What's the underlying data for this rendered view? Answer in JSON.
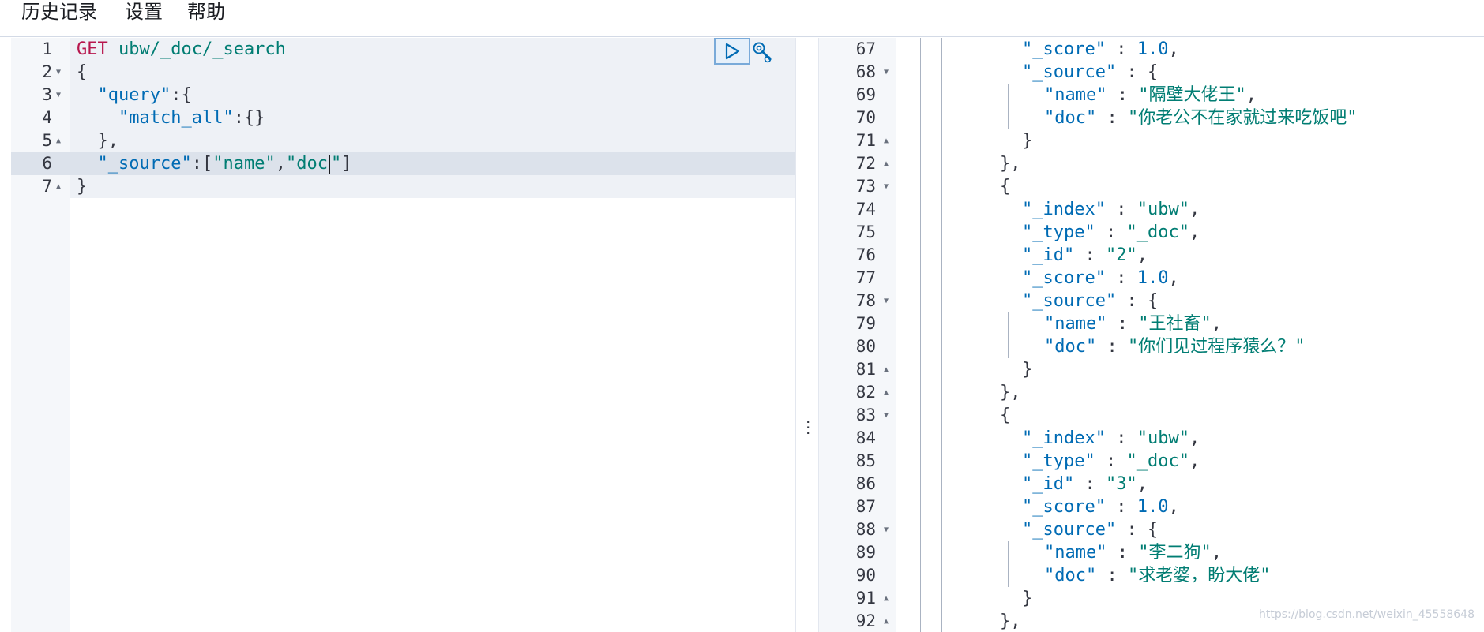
{
  "menu": {
    "history": "历史记录",
    "settings": "设置",
    "help": "帮助"
  },
  "request": {
    "lines": [
      {
        "num": "1",
        "fold": "",
        "tokens": [
          [
            "m",
            "GET"
          ],
          [
            "p",
            " "
          ],
          [
            "s",
            "ubw/_doc/_search"
          ]
        ]
      },
      {
        "num": "2",
        "fold": "down",
        "tokens": [
          [
            "p",
            "{"
          ]
        ]
      },
      {
        "num": "3",
        "fold": "down",
        "tokens": [
          [
            "p",
            "  "
          ],
          [
            "k",
            "\"query\""
          ],
          [
            "p",
            ":{"
          ]
        ]
      },
      {
        "num": "4",
        "fold": "",
        "tokens": [
          [
            "p",
            "    "
          ],
          [
            "k",
            "\"match_all\""
          ],
          [
            "p",
            ":{}"
          ]
        ]
      },
      {
        "num": "5",
        "fold": "up",
        "tokens": [
          [
            "p",
            "  },"
          ]
        ]
      },
      {
        "num": "6",
        "fold": "",
        "tokens": [
          [
            "p",
            "  "
          ],
          [
            "k",
            "\"_source\""
          ],
          [
            "p",
            ":["
          ],
          [
            "s",
            "\"name\""
          ],
          [
            "p",
            ","
          ],
          [
            "s",
            "\"doc"
          ],
          [
            "caret",
            ""
          ],
          [
            "s",
            "\""
          ],
          [
            "p",
            "]"
          ]
        ]
      },
      {
        "num": "7",
        "fold": "up",
        "tokens": [
          [
            "p",
            "}"
          ]
        ]
      }
    ]
  },
  "response": {
    "lines": [
      {
        "num": "67",
        "fold": "",
        "indent": 4,
        "tokens": [
          [
            "k",
            "\"_score\""
          ],
          [
            "p",
            " : "
          ],
          [
            "n",
            "1.0"
          ],
          [
            "p",
            ","
          ]
        ]
      },
      {
        "num": "68",
        "fold": "down",
        "indent": 4,
        "tokens": [
          [
            "k",
            "\"_source\""
          ],
          [
            "p",
            " : {"
          ]
        ]
      },
      {
        "num": "69",
        "fold": "",
        "indent": 5,
        "tokens": [
          [
            "k",
            "\"name\""
          ],
          [
            "p",
            " : "
          ],
          [
            "s",
            "\"隔壁大佬王\""
          ],
          [
            "p",
            ","
          ]
        ]
      },
      {
        "num": "70",
        "fold": "",
        "indent": 5,
        "tokens": [
          [
            "k",
            "\"doc\""
          ],
          [
            "p",
            " : "
          ],
          [
            "s",
            "\"你老公不在家就过来吃饭吧\""
          ]
        ]
      },
      {
        "num": "71",
        "fold": "up",
        "indent": 4,
        "tokens": [
          [
            "p",
            "}"
          ]
        ]
      },
      {
        "num": "72",
        "fold": "up",
        "indent": 3,
        "tokens": [
          [
            "p",
            "},"
          ]
        ]
      },
      {
        "num": "73",
        "fold": "down",
        "indent": 3,
        "tokens": [
          [
            "p",
            "{"
          ]
        ]
      },
      {
        "num": "74",
        "fold": "",
        "indent": 4,
        "tokens": [
          [
            "k",
            "\"_index\""
          ],
          [
            "p",
            " : "
          ],
          [
            "s",
            "\"ubw\""
          ],
          [
            "p",
            ","
          ]
        ]
      },
      {
        "num": "75",
        "fold": "",
        "indent": 4,
        "tokens": [
          [
            "k",
            "\"_type\""
          ],
          [
            "p",
            " : "
          ],
          [
            "s",
            "\"_doc\""
          ],
          [
            "p",
            ","
          ]
        ]
      },
      {
        "num": "76",
        "fold": "",
        "indent": 4,
        "tokens": [
          [
            "k",
            "\"_id\""
          ],
          [
            "p",
            " : "
          ],
          [
            "s",
            "\"2\""
          ],
          [
            "p",
            ","
          ]
        ]
      },
      {
        "num": "77",
        "fold": "",
        "indent": 4,
        "tokens": [
          [
            "k",
            "\"_score\""
          ],
          [
            "p",
            " : "
          ],
          [
            "n",
            "1.0"
          ],
          [
            "p",
            ","
          ]
        ]
      },
      {
        "num": "78",
        "fold": "down",
        "indent": 4,
        "tokens": [
          [
            "k",
            "\"_source\""
          ],
          [
            "p",
            " : {"
          ]
        ]
      },
      {
        "num": "79",
        "fold": "",
        "indent": 5,
        "tokens": [
          [
            "k",
            "\"name\""
          ],
          [
            "p",
            " : "
          ],
          [
            "s",
            "\"王社畜\""
          ],
          [
            "p",
            ","
          ]
        ]
      },
      {
        "num": "80",
        "fold": "",
        "indent": 5,
        "tokens": [
          [
            "k",
            "\"doc\""
          ],
          [
            "p",
            " : "
          ],
          [
            "s",
            "\"你们见过程序猿么？\""
          ]
        ]
      },
      {
        "num": "81",
        "fold": "up",
        "indent": 4,
        "tokens": [
          [
            "p",
            "}"
          ]
        ]
      },
      {
        "num": "82",
        "fold": "up",
        "indent": 3,
        "tokens": [
          [
            "p",
            "},"
          ]
        ]
      },
      {
        "num": "83",
        "fold": "down",
        "indent": 3,
        "tokens": [
          [
            "p",
            "{"
          ]
        ]
      },
      {
        "num": "84",
        "fold": "",
        "indent": 4,
        "tokens": [
          [
            "k",
            "\"_index\""
          ],
          [
            "p",
            " : "
          ],
          [
            "s",
            "\"ubw\""
          ],
          [
            "p",
            ","
          ]
        ]
      },
      {
        "num": "85",
        "fold": "",
        "indent": 4,
        "tokens": [
          [
            "k",
            "\"_type\""
          ],
          [
            "p",
            " : "
          ],
          [
            "s",
            "\"_doc\""
          ],
          [
            "p",
            ","
          ]
        ]
      },
      {
        "num": "86",
        "fold": "",
        "indent": 4,
        "tokens": [
          [
            "k",
            "\"_id\""
          ],
          [
            "p",
            " : "
          ],
          [
            "s",
            "\"3\""
          ],
          [
            "p",
            ","
          ]
        ]
      },
      {
        "num": "87",
        "fold": "",
        "indent": 4,
        "tokens": [
          [
            "k",
            "\"_score\""
          ],
          [
            "p",
            " : "
          ],
          [
            "n",
            "1.0"
          ],
          [
            "p",
            ","
          ]
        ]
      },
      {
        "num": "88",
        "fold": "down",
        "indent": 4,
        "tokens": [
          [
            "k",
            "\"_source\""
          ],
          [
            "p",
            " : {"
          ]
        ]
      },
      {
        "num": "89",
        "fold": "",
        "indent": 5,
        "tokens": [
          [
            "k",
            "\"name\""
          ],
          [
            "p",
            " : "
          ],
          [
            "s",
            "\"李二狗\""
          ],
          [
            "p",
            ","
          ]
        ]
      },
      {
        "num": "90",
        "fold": "",
        "indent": 5,
        "tokens": [
          [
            "k",
            "\"doc\""
          ],
          [
            "p",
            " : "
          ],
          [
            "s",
            "\"求老婆，盼大佬\""
          ]
        ]
      },
      {
        "num": "91",
        "fold": "up",
        "indent": 4,
        "tokens": [
          [
            "p",
            "}"
          ]
        ]
      },
      {
        "num": "92",
        "fold": "up",
        "indent": 3,
        "tokens": [
          [
            "p",
            "},"
          ]
        ]
      }
    ]
  },
  "watermark": "https://blog.csdn.net/weixin_45558648",
  "icons": {
    "run": "play-icon",
    "settings": "wrench-icon",
    "resize": "vertical-dots-icon"
  },
  "colors": {
    "keyword": "#006bb4",
    "string": "#017d73",
    "method": "#b7164d",
    "run_border": "#79aad9"
  }
}
